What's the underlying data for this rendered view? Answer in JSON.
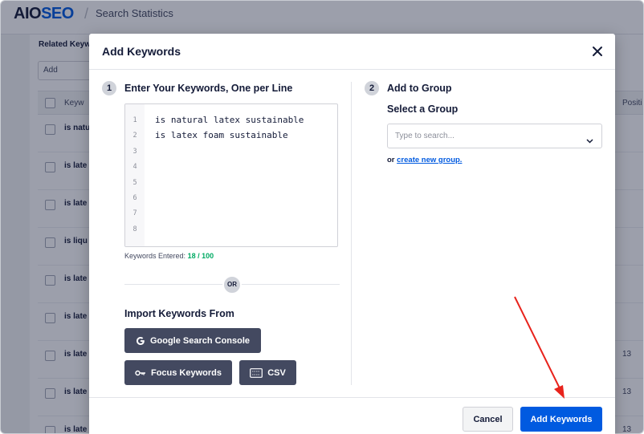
{
  "background": {
    "logo": {
      "part1": "AIO",
      "part2": "SEO"
    },
    "breadcrumb_separator": "/",
    "breadcrumb": "Search Statistics",
    "related_label": "Related Keyw",
    "add_input_value": "Add",
    "column_keyword": "Keyw",
    "column_position": "Positi",
    "rows": [
      {
        "text": "is natur",
        "number": ""
      },
      {
        "text": "is late",
        "number": ""
      },
      {
        "text": "is late",
        "number": ""
      },
      {
        "text": "is liqu",
        "number": ""
      },
      {
        "text": "is late",
        "number": ""
      },
      {
        "text": "is late",
        "number": ""
      },
      {
        "text": "is late",
        "number": "13"
      },
      {
        "text": "is late",
        "number": "13"
      },
      {
        "text": "is late",
        "number": "13"
      }
    ]
  },
  "modal": {
    "title": "Add Keywords",
    "close_icon": "close-icon",
    "step1": {
      "number": "1",
      "title": "Enter Your Keywords, One per Line",
      "lines": [
        {
          "num": "1",
          "text": "is natural latex sustainable"
        },
        {
          "num": "2",
          "text": "is latex foam sustainable"
        },
        {
          "num": "3",
          "text": ""
        },
        {
          "num": "4",
          "text": ""
        },
        {
          "num": "5",
          "text": ""
        },
        {
          "num": "6",
          "text": ""
        },
        {
          "num": "7",
          "text": ""
        },
        {
          "num": "8",
          "text": ""
        }
      ],
      "count_label": "Keywords Entered:",
      "count_value": "18 / 100",
      "or_label": "OR",
      "import_title": "Import Keywords From",
      "import_buttons": {
        "google": "Google Search Console",
        "focus": "Focus Keywords",
        "csv": "CSV"
      }
    },
    "step2": {
      "number": "2",
      "title": "Add to Group",
      "select_label": "Select a Group",
      "select_placeholder": "Type to search...",
      "or_prefix": "or",
      "create_link": "create new group."
    },
    "footer": {
      "cancel": "Cancel",
      "add": "Add Keywords"
    }
  },
  "colors": {
    "accent": "#005ae0",
    "count_green": "#00aa63",
    "dark_button": "#434960",
    "annotation_arrow": "#e8231c"
  }
}
